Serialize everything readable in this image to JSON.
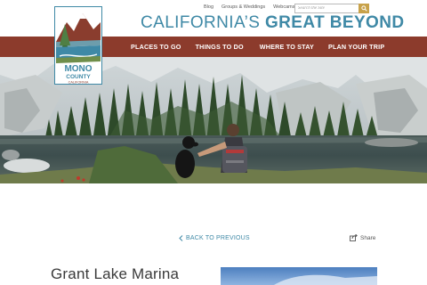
{
  "utility_links": [
    "Blog",
    "Groups & Weddings",
    "Webcams"
  ],
  "search": {
    "placeholder": "Search the Site"
  },
  "tagline": {
    "part1": "CALIFORNIA’S",
    "part2": "GREAT BEYOND"
  },
  "logo": {
    "line1": "MONO",
    "line2": "COUNTY",
    "line3": "CALIFORNIA"
  },
  "nav": [
    "PLACES TO GO",
    "THINGS TO DO",
    "WHERE TO STAY",
    "PLAN YOUR TRIP"
  ],
  "back_link": "BACK TO PREVIOUS",
  "share_label": "Share",
  "page_title": "Grant Lake Marina",
  "colors": {
    "brand_blue": "#3f89a6",
    "nav_bar": "#8c3b2c",
    "search_button": "#c8a24a"
  },
  "icons": {
    "search": "search-icon",
    "back": "chevron-left-icon",
    "share": "share-icon"
  }
}
